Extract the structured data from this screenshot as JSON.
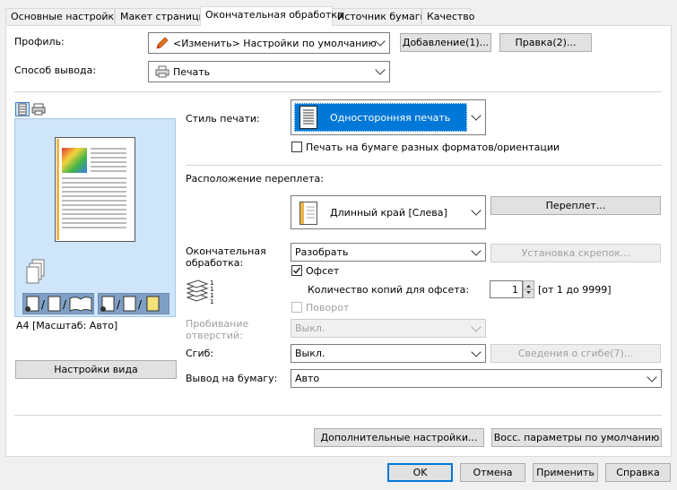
{
  "tabs": [
    {
      "label": "Основные настройки"
    },
    {
      "label": "Макет страницы"
    },
    {
      "label": "Окончательная обработка"
    },
    {
      "label": "Источник бумаги"
    },
    {
      "label": "Качество"
    }
  ],
  "profile": {
    "label": "Профиль:",
    "value": "<Изменить> Настройки по умолчанию",
    "icon": "pencil-icon",
    "add_button": "Добавление(1)...",
    "edit_button": "Правка(2)..."
  },
  "output_method": {
    "label": "Способ вывода:",
    "value": "Печать",
    "icon": "printer-icon"
  },
  "preview": {
    "caption": "А4 [Масштаб: Авто]",
    "view_settings_button": "Настройки вида"
  },
  "print_style": {
    "label": "Стиль печати:",
    "value": "Односторонняя печать",
    "highlight_color": "#0078d7"
  },
  "mixed_formats": {
    "label": "Печать на бумаге разных форматов/ориентации",
    "checked": false
  },
  "binding": {
    "label": "Расположение переплета:",
    "value": "Длинный край [Слева]",
    "button": "Переплет..."
  },
  "finishing": {
    "label": "Окончательная обработка:",
    "value": "Разобрать",
    "staple_button": "Установка скрепок..."
  },
  "offset": {
    "label": "Офсет",
    "checked": true,
    "copies_label": "Количество копий для офсета:",
    "copies_value": "1",
    "range_label": "[от 1 до 9999]"
  },
  "rotate": {
    "label": "Поворот",
    "checked": false
  },
  "punch": {
    "label": "Пробивание отверстий:",
    "value": "Выкл."
  },
  "fold": {
    "label": "Сгиб:",
    "value": "Выкл.",
    "button": "Сведения о сгибе(7)..."
  },
  "paper_output": {
    "label": "Вывод на бумагу:",
    "value": "Авто"
  },
  "panel_buttons": {
    "advanced": "Дополнительные настройки...",
    "restore_defaults": "Восс. параметры по умолчанию"
  },
  "dialog_buttons": {
    "ok": "OK",
    "cancel": "Отмена",
    "apply": "Применить",
    "help": "Справка"
  }
}
